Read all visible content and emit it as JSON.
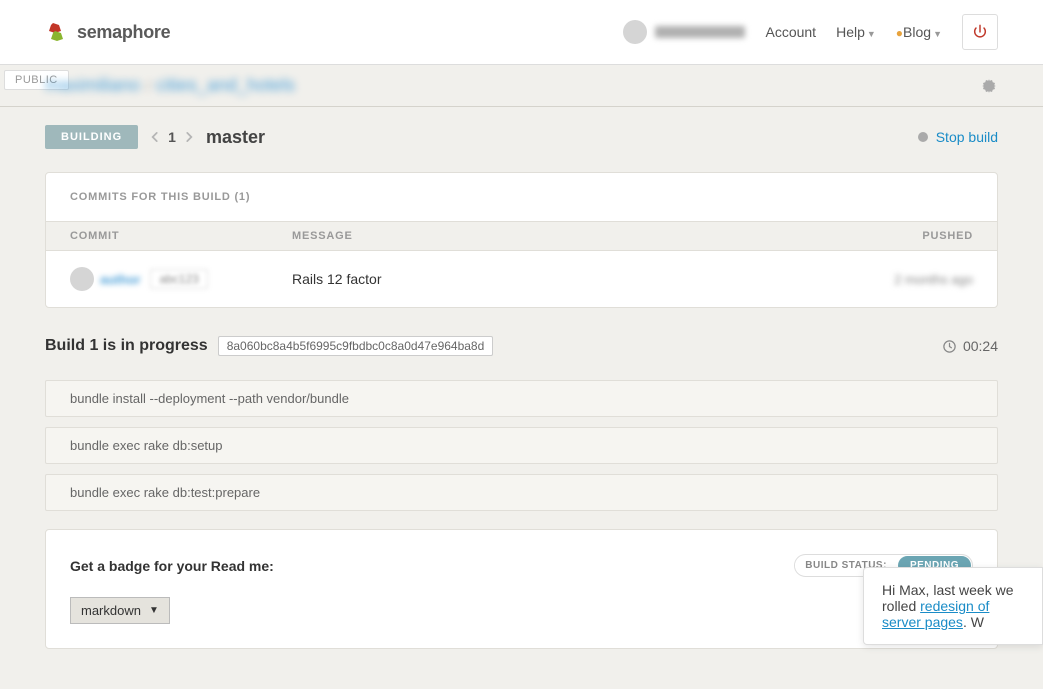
{
  "brand": "semaphore",
  "nav": {
    "account": "Account",
    "help": "Help",
    "blog": "Blog"
  },
  "visibility": "PUBLIC",
  "breadcrumb": {
    "owner": "maximiliano",
    "repo": "cities_and_hotels"
  },
  "build": {
    "status_badge": "BUILDING",
    "number": "1",
    "branch": "master",
    "stop": "Stop build"
  },
  "commits": {
    "heading": "COMMITS FOR THIS BUILD (1)",
    "cols": {
      "commit": "COMMIT",
      "message": "MESSAGE",
      "pushed": "PUSHED"
    },
    "rows": [
      {
        "user": "author",
        "hash": "abc123",
        "message": "Rails 12 factor",
        "pushed": "2 months ago"
      }
    ]
  },
  "progress": {
    "title": "Build 1 is in progress",
    "sha": "8a060bc8a4b5f6995c9fbdbc0c8a0d47e964ba8d",
    "elapsed": "00:24"
  },
  "commands": [
    "bundle install --deployment --path vendor/bundle",
    "bundle exec rake db:setup",
    "bundle exec rake db:test:prepare"
  ],
  "badge_section": {
    "title": "Get a badge for your Read me:",
    "status_label": "BUILD STATUS:",
    "status_value": "PENDING",
    "format": "markdown"
  },
  "chat": {
    "greeting": "Hi Max, last week we rolled",
    "link": "redesign of server pages",
    "tail": ". W"
  }
}
